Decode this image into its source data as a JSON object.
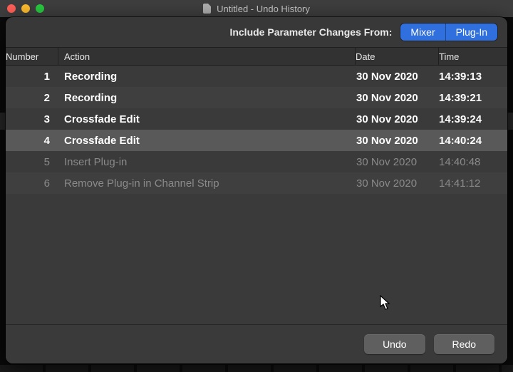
{
  "window": {
    "title": "Untitled - Undo History"
  },
  "top": {
    "label": "Include Parameter Changes From:",
    "mixer": "Mixer",
    "plugin": "Plug-In"
  },
  "columns": {
    "number": "Number",
    "action": "Action",
    "date": "Date",
    "time": "Time"
  },
  "rows": [
    {
      "num": "1",
      "action": "Recording",
      "date": "30 Nov 2020",
      "time": "14:39:13",
      "state": "past"
    },
    {
      "num": "2",
      "action": "Recording",
      "date": "30 Nov 2020",
      "time": "14:39:21",
      "state": "past"
    },
    {
      "num": "3",
      "action": "Crossfade Edit",
      "date": "30 Nov 2020",
      "time": "14:39:24",
      "state": "past"
    },
    {
      "num": "4",
      "action": "Crossfade Edit",
      "date": "30 Nov 2020",
      "time": "14:40:24",
      "state": "selected"
    },
    {
      "num": "5",
      "action": "Insert Plug-in",
      "date": "30 Nov 2020",
      "time": "14:40:48",
      "state": "future"
    },
    {
      "num": "6",
      "action": "Remove Plug-in in Channel Strip",
      "date": "30 Nov 2020",
      "time": "14:41:12",
      "state": "future"
    }
  ],
  "footer": {
    "undo": "Undo",
    "redo": "Redo"
  }
}
